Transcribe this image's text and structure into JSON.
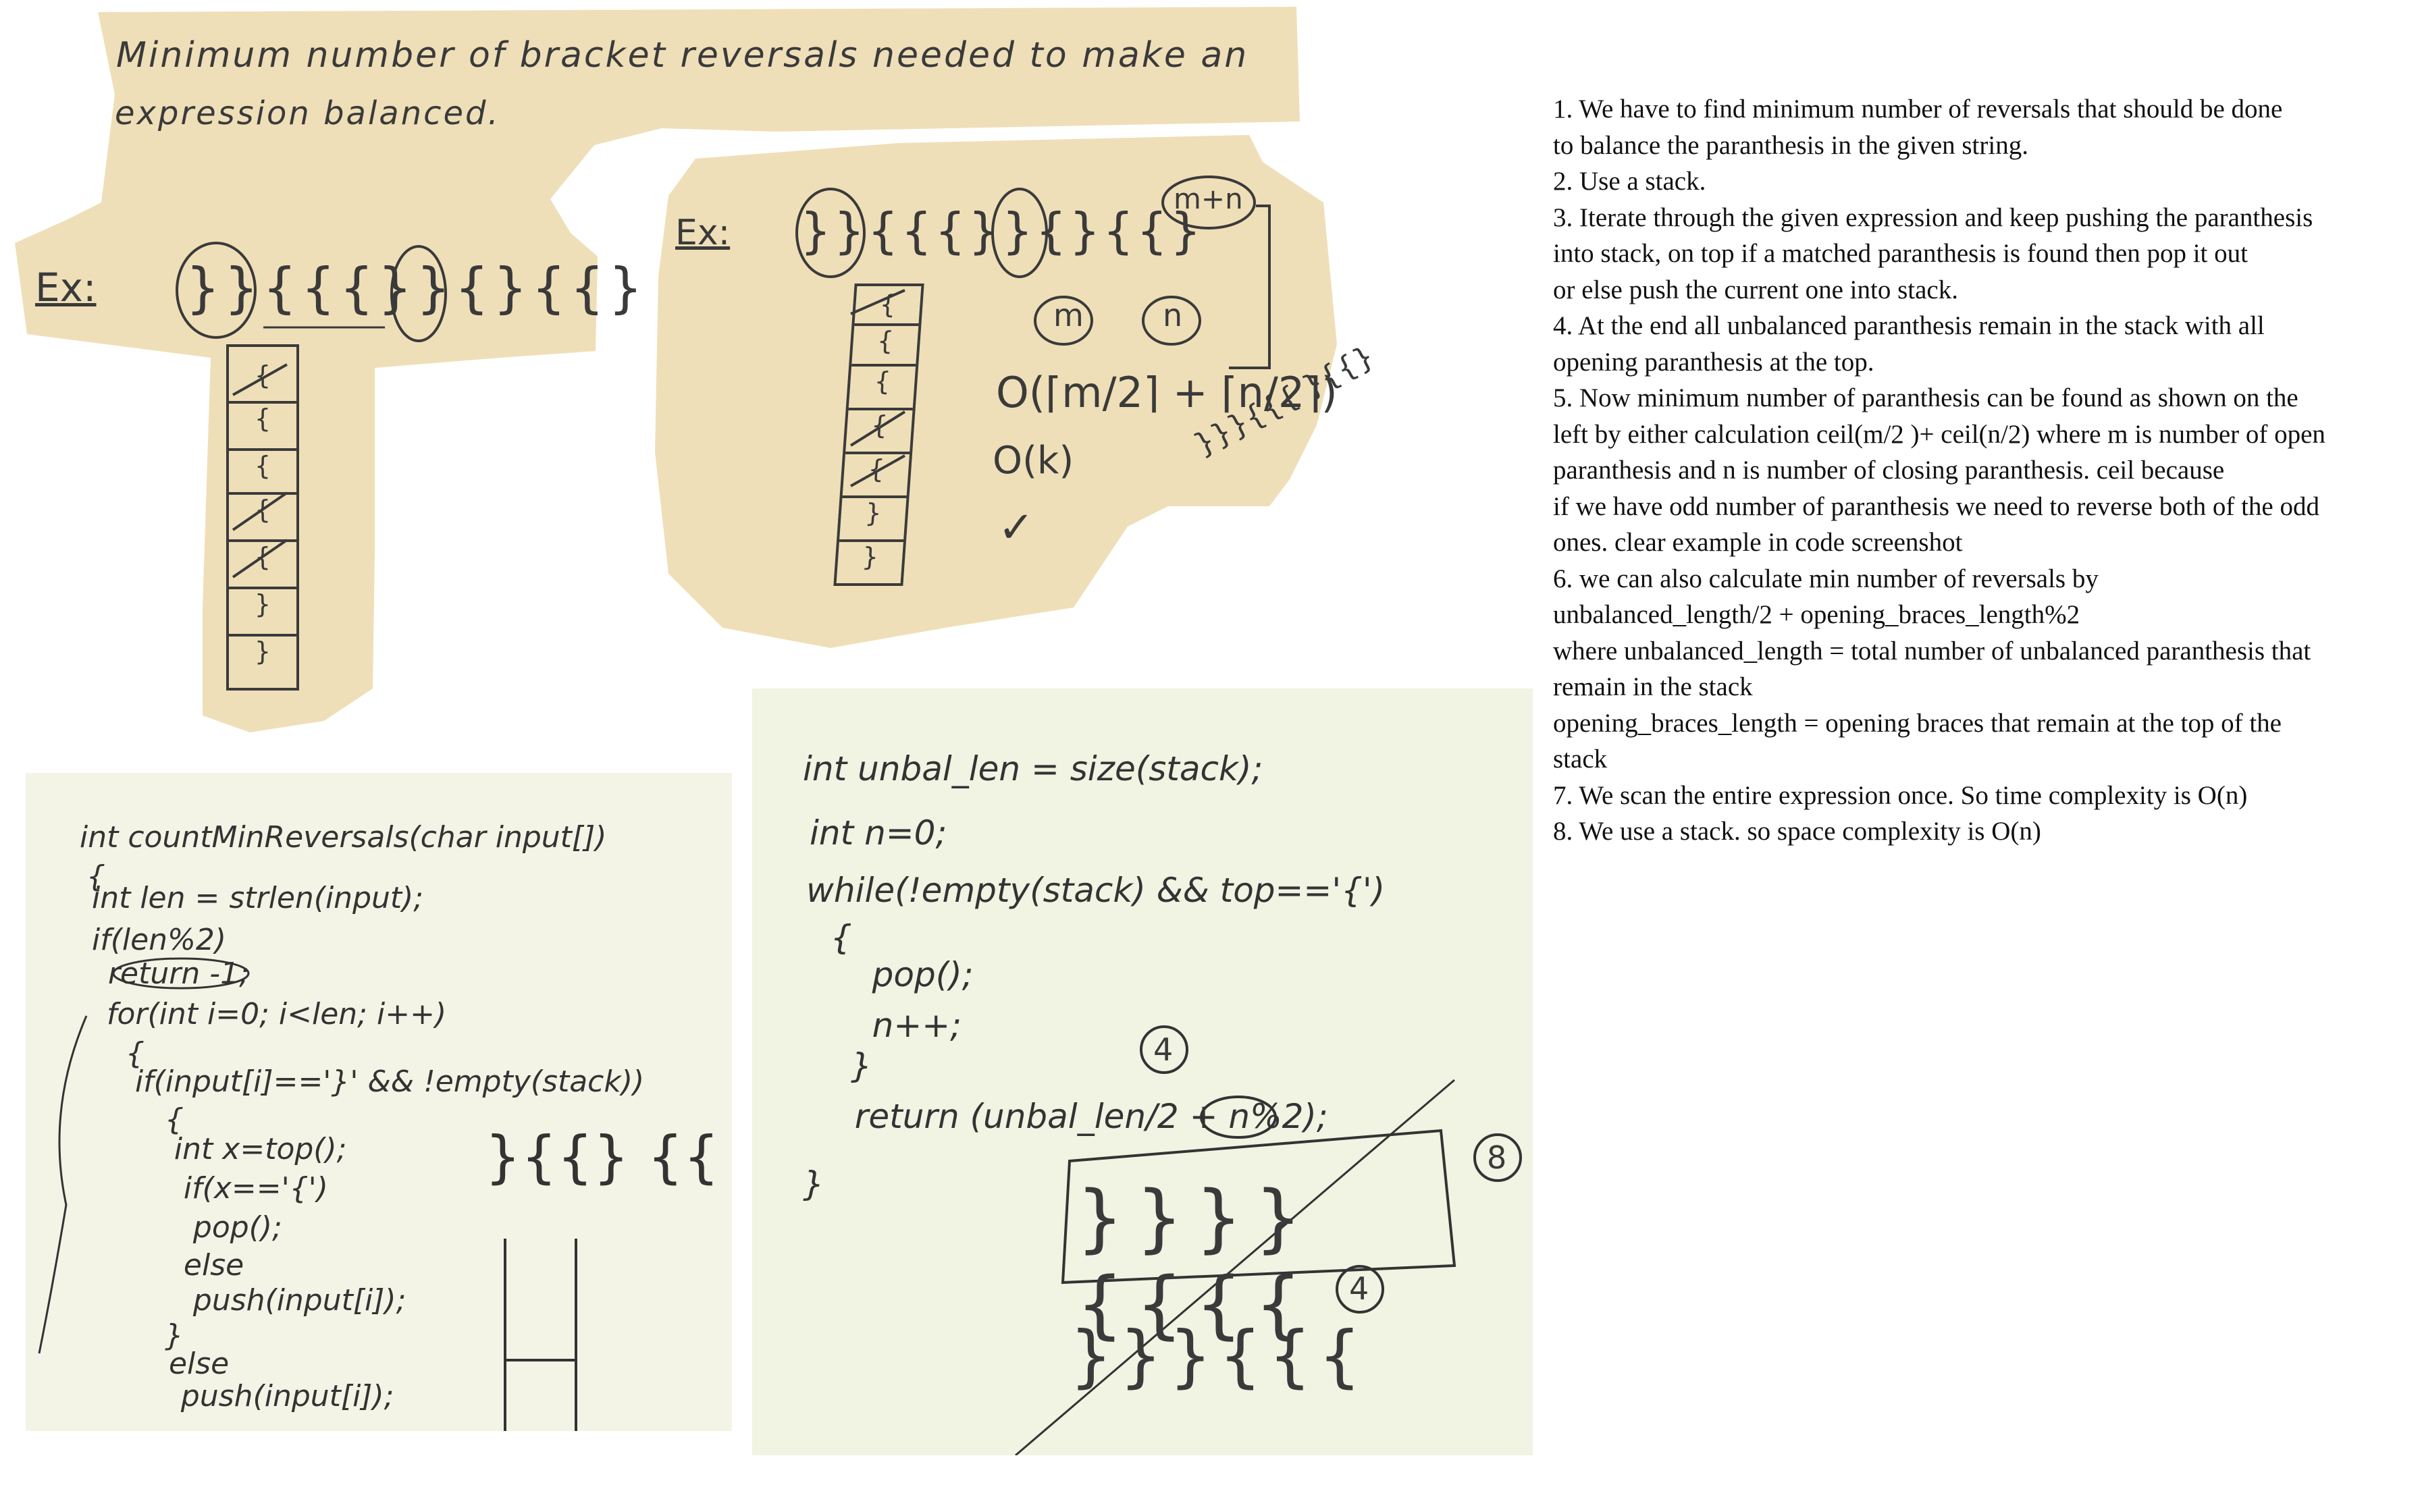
{
  "note_left": {
    "title_line1": "Minimum number of bracket reversals needed to make an",
    "title_line2": "expression balanced.",
    "example_label": "Ex:",
    "example_expr": "}}{{{}}{}{{}",
    "stack_cells": [
      "{",
      "{",
      "{",
      "{",
      "{",
      "}",
      "}"
    ]
  },
  "note_right": {
    "example_label": "Ex:",
    "example_expr": "}}{{{}}{}{{}",
    "bubble_mn": "m+n",
    "bubble_m": "m",
    "bubble_n": "n",
    "formula": "O(⌈m/2⌉ + ⌈n/2⌉)",
    "complexity": "O(k)",
    "check": "✓",
    "stack_cells": [
      "{",
      "{",
      "{",
      "{",
      "{",
      "}",
      "}"
    ],
    "scribble": "}}}{{{ }{{}"
  },
  "board_left": {
    "lines": [
      "int countMinReversals(char input[])",
      "{",
      "  int len = strlen(input);",
      "  if(len%2)",
      "   return -1;",
      "for(int i=0; i<len; i++)",
      "  {",
      "   if(input[i]=='}' && !empty(stack))",
      "    {",
      "     int x=top();",
      "      if(x=='{')",
      "       pop();",
      "      else",
      "       push(input[i]);",
      "    }",
      "   else",
      "     push(input[i]);"
    ],
    "side_braces": "}{{} {{"
  },
  "board_right": {
    "lines": [
      "int unbal_len = size(stack);",
      "int n=0;",
      "while(!empty(stack) && top=='{')",
      " {",
      "   pop();",
      "   n++;",
      " }",
      "  return (unbal_len/2 + n%2);",
      "}"
    ],
    "circle_4a": "4",
    "circle_8": "8",
    "circle_4b": "4",
    "row1": "}}}}{{{{",
    "row2": "}}}{{{"
  },
  "explanation": [
    "1. We have to find minimum number of reversals that should be done",
    "to balance the paranthesis in the given string.",
    "2. Use a stack.",
    "3. Iterate through the given expression and keep pushing the paranthesis",
    "into stack, on top if a matched paranthesis is found then pop it out",
    "or else push the current one into stack.",
    "4. At the end all unbalanced paranthesis remain in the stack with all",
    "opening paranthesis at the top.",
    "5. Now minimum number of paranthesis can be found as shown on the",
    "left by either calculation ceil(m/2 )+ ceil(n/2) where m is number of open",
    "paranthesis and n is number of closing paranthesis. ceil because",
    "if we have odd number of paranthesis we need to reverse both of the odd",
    "ones. clear example in code screenshot",
    "6. we can also calculate min number of reversals by",
    "unbalanced_length/2 + opening_braces_length%2",
    "where unbalanced_length = total number of unbalanced paranthesis that",
    "remain in the stack",
    "opening_braces_length =  opening braces that remain at the top of the",
    "stack",
    "7. We scan the entire expression once. So time complexity is O(n)",
    "8. We use a stack. so space complexity is O(n)"
  ],
  "colors": {
    "note_bg": "#efdfb8",
    "board_bg": "#f3f4e4",
    "ink": "#3a3a3a"
  }
}
